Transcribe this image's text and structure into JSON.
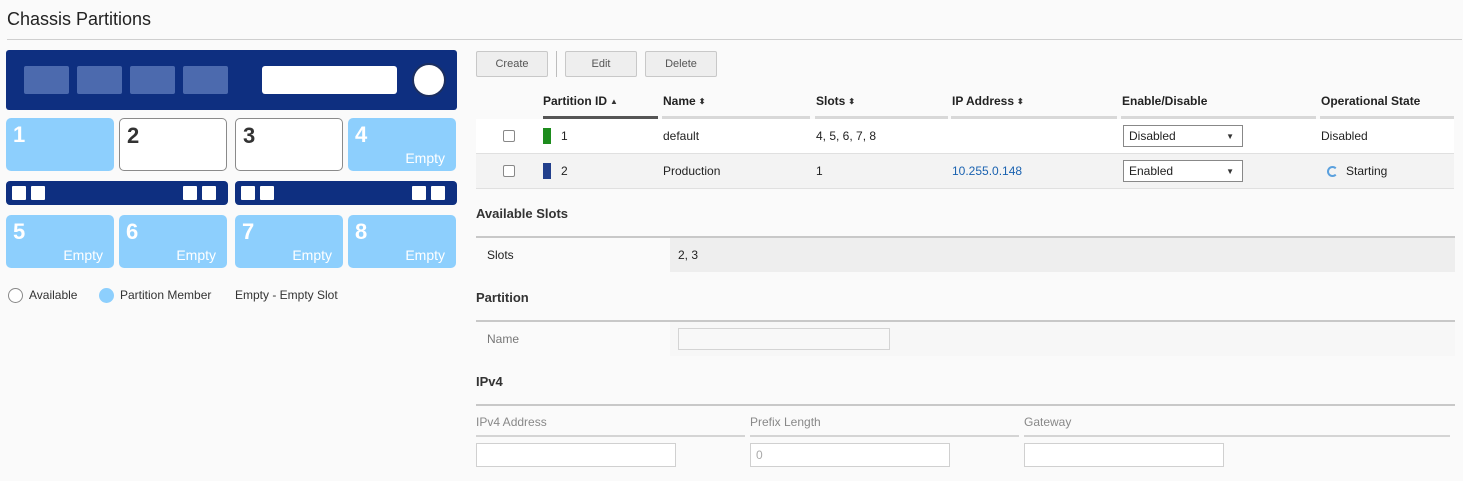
{
  "page": {
    "title": "Chassis Partitions"
  },
  "chassis": {
    "slots": [
      {
        "num": "1",
        "tag": "",
        "state": "member"
      },
      {
        "num": "2",
        "tag": "",
        "state": "available"
      },
      {
        "num": "3",
        "tag": "",
        "state": "available"
      },
      {
        "num": "4",
        "tag": "Empty",
        "state": "member"
      },
      {
        "num": "5",
        "tag": "Empty",
        "state": "member"
      },
      {
        "num": "6",
        "tag": "Empty",
        "state": "member"
      },
      {
        "num": "7",
        "tag": "Empty",
        "state": "member"
      },
      {
        "num": "8",
        "tag": "Empty",
        "state": "member"
      }
    ],
    "colors": {
      "frame": "#0e2f80",
      "member": "#8dcffd"
    },
    "legend": {
      "available": "Available",
      "member": "Partition Member",
      "empty": "Empty - Empty Slot"
    }
  },
  "toolbar": {
    "create": "Create",
    "edit": "Edit",
    "delete": "Delete"
  },
  "table": {
    "headers": {
      "partition_id": "Partition ID",
      "name": "Name",
      "slots": "Slots",
      "ip": "IP Address",
      "enable": "Enable/Disable",
      "state": "Operational State"
    },
    "rows": [
      {
        "id": "1",
        "color": "#1d8c1d",
        "name": "default",
        "slots": "4, 5, 6, 7, 8",
        "ip": "",
        "enable": "Disabled",
        "state": "Disabled"
      },
      {
        "id": "2",
        "color": "#223f8c",
        "name": "Production",
        "slots": "1",
        "ip": "10.255.0.148",
        "enable": "Enabled",
        "state": "Starting"
      }
    ]
  },
  "available_slots": {
    "title": "Available Slots",
    "label": "Slots",
    "value": "2, 3"
  },
  "partition": {
    "title": "Partition",
    "name_label": "Name",
    "name_value": ""
  },
  "ipv4": {
    "title": "IPv4",
    "address_label": "IPv4 Address",
    "prefix_label": "Prefix Length",
    "prefix_value": "0",
    "gateway_label": "Gateway"
  }
}
